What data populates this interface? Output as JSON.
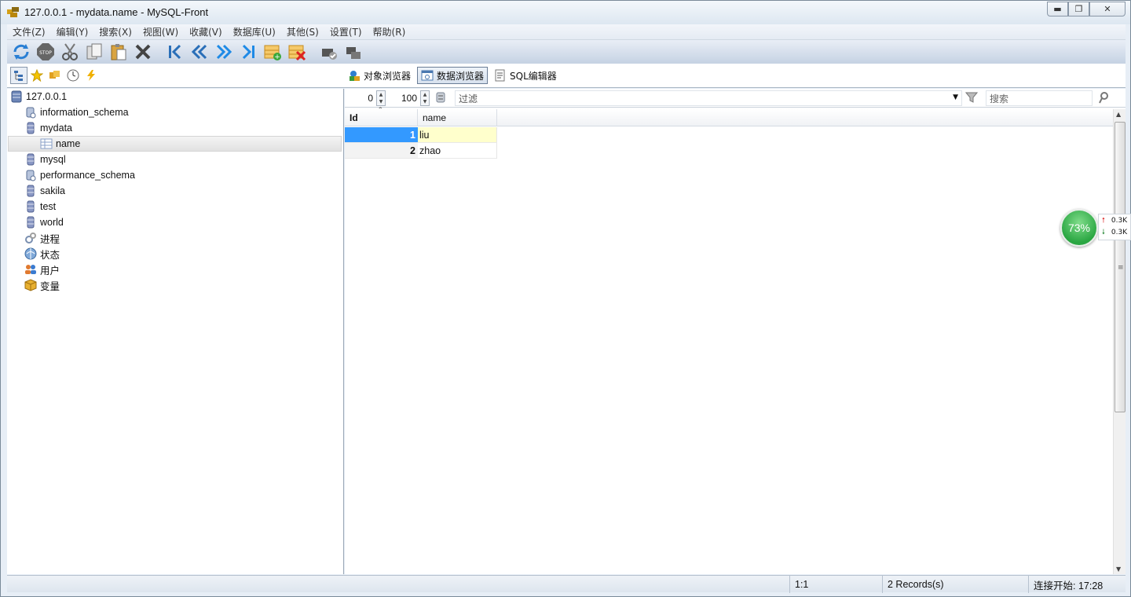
{
  "window": {
    "title": "127.0.0.1 - mydata.name - MySQL-Front"
  },
  "menu": [
    "文件(Z)",
    "编辑(Y)",
    "搜索(X)",
    "视图(W)",
    "收藏(V)",
    "数据库(U)",
    "其他(S)",
    "设置(T)",
    "帮助(R)"
  ],
  "toolbar": {
    "icons": [
      "refresh-icon",
      "stop-icon",
      "cut-icon",
      "copy-icon",
      "paste-icon",
      "delete-icon",
      "first-icon",
      "prev-icon",
      "next-icon",
      "last-icon",
      "insert-row-icon",
      "delete-row-icon",
      "commit-icon",
      "rollback-icon"
    ]
  },
  "views": {
    "object_browser": "对象浏览器",
    "data_browser": "数据浏览器",
    "sql_editor": "SQL编辑器"
  },
  "tree": {
    "root": "127.0.0.1",
    "items": [
      {
        "label": "information_schema",
        "icon": "system-db-icon"
      },
      {
        "label": "mydata",
        "icon": "database-icon"
      },
      {
        "label": "name",
        "icon": "table-icon"
      },
      {
        "label": "mysql",
        "icon": "database-icon"
      },
      {
        "label": "performance_schema",
        "icon": "system-db-icon"
      },
      {
        "label": "sakila",
        "icon": "database-icon"
      },
      {
        "label": "test",
        "icon": "database-icon"
      },
      {
        "label": "world",
        "icon": "database-icon"
      },
      {
        "label": "进程",
        "icon": "process-icon"
      },
      {
        "label": "状态",
        "icon": "status-icon"
      },
      {
        "label": "用户",
        "icon": "users-icon"
      },
      {
        "label": "变量",
        "icon": "variables-icon"
      }
    ]
  },
  "filterbar": {
    "offset": "0",
    "limit": "100",
    "filter_placeholder": "过滤",
    "search_placeholder": "搜索"
  },
  "grid": {
    "columns": [
      "Id",
      "name"
    ],
    "rows": [
      {
        "id": "1",
        "name": "liu"
      },
      {
        "id": "2",
        "name": "zhao"
      }
    ]
  },
  "status": {
    "position": "1:1",
    "records": "2 Records(s)",
    "connected": "连接开始: 17:28"
  },
  "widget": {
    "percent": "73%",
    "up": "0.3K",
    "down": "0.3K"
  },
  "colors": {
    "selection": "#3399ff",
    "cell_highlight": "#ffffcc",
    "gauge": "#2aa642"
  }
}
